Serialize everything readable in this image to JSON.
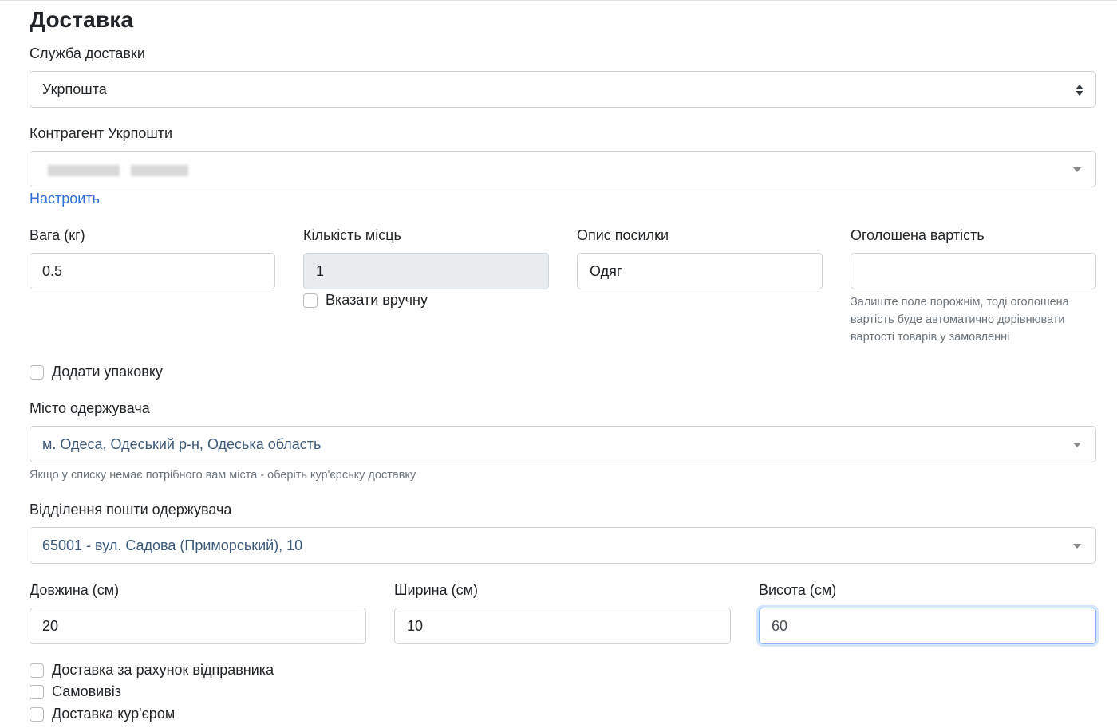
{
  "section": {
    "title": "Доставка"
  },
  "delivery_service": {
    "label": "Служба доставки",
    "value": "Укрпошта"
  },
  "counterparty": {
    "label": "Контрагент Укрпошти",
    "configure_link": "Настроить"
  },
  "weight": {
    "label": "Вага (кг)",
    "value": "0.5"
  },
  "places": {
    "label": "Кількість місць",
    "value": "1",
    "manual_label": "Вказати вручну"
  },
  "description": {
    "label": "Опис посилки",
    "value": "Одяг"
  },
  "declared_value": {
    "label": "Оголошена вартість",
    "value": "",
    "help_line1": "Залиште поле порожнім, тоді оголошена",
    "help_line2": "вартість буде автоматично дорівнювати",
    "help_line3": "вартості товарів у замовленні"
  },
  "packaging": {
    "label": "Додати упаковку"
  },
  "recipient_city": {
    "label": "Місто одержувача",
    "value": "м. Одеса, Одеський р-н, Одеська область",
    "help": "Якщо у списку немає потрібного вам міста - оберіть кур'єрську доставку"
  },
  "recipient_branch": {
    "label": "Відділення пошти одержувача",
    "value": "65001 - вул. Садова (Приморський), 10"
  },
  "length": {
    "label": "Довжина (см)",
    "value": "20"
  },
  "width": {
    "label": "Ширина (см)",
    "value": "10"
  },
  "height": {
    "label": "Висота (см)",
    "value": "60"
  },
  "options": {
    "sender_pays": "Доставка за рахунок відправника",
    "pickup": "Самовивіз",
    "courier": "Доставка кур'єром"
  }
}
